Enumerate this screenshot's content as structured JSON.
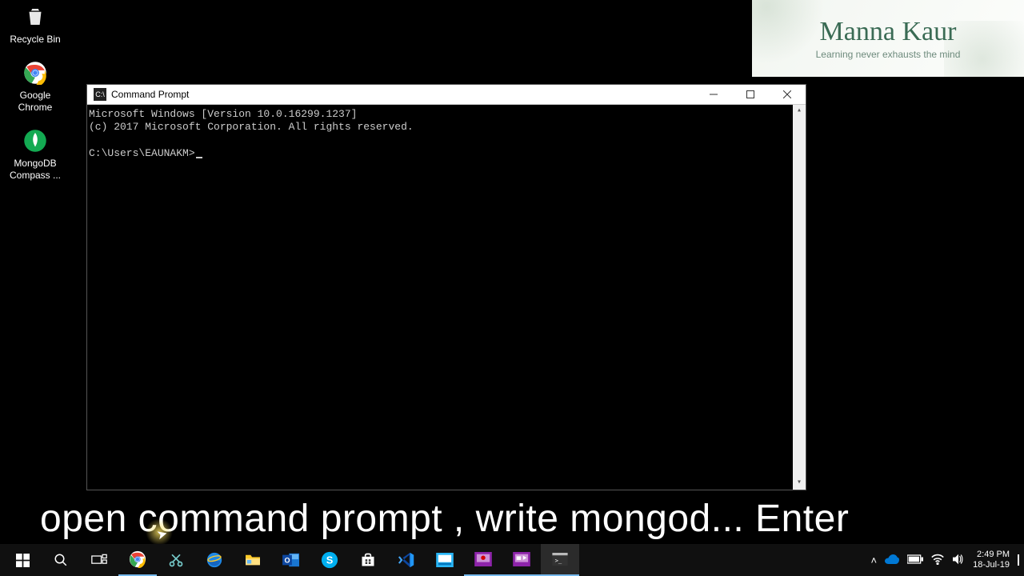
{
  "desktop": {
    "icons": [
      {
        "name": "recycle-bin",
        "label": "Recycle Bin"
      },
      {
        "name": "google-chrome",
        "label": "Google Chrome"
      },
      {
        "name": "mongodb-compass",
        "label": "MongoDB Compass ..."
      }
    ]
  },
  "brand": {
    "name": "Manna Kaur",
    "tagline": "Learning never exhausts the mind"
  },
  "cmd": {
    "title": "Command Prompt",
    "line1": "Microsoft Windows [Version 10.0.16299.1237]",
    "line2": "(c) 2017 Microsoft Corporation. All rights reserved.",
    "prompt": "C:\\Users\\EAUNAKM>"
  },
  "subtitle": "open command prompt , write mongod... Enter",
  "taskbar": {
    "items": [
      "start",
      "search",
      "task-view",
      "chrome",
      "snip",
      "ie",
      "file-explorer",
      "outlook",
      "skype",
      "store",
      "vscode",
      "settings-app",
      "recorder1",
      "recorder2",
      "cmd"
    ]
  },
  "tray": {
    "chevron": "˄",
    "onedrive": "cloud",
    "battery": "battery",
    "wifi": "wifi",
    "volume": "volume",
    "time": "2:49 PM",
    "date": "18-Jul-19"
  }
}
